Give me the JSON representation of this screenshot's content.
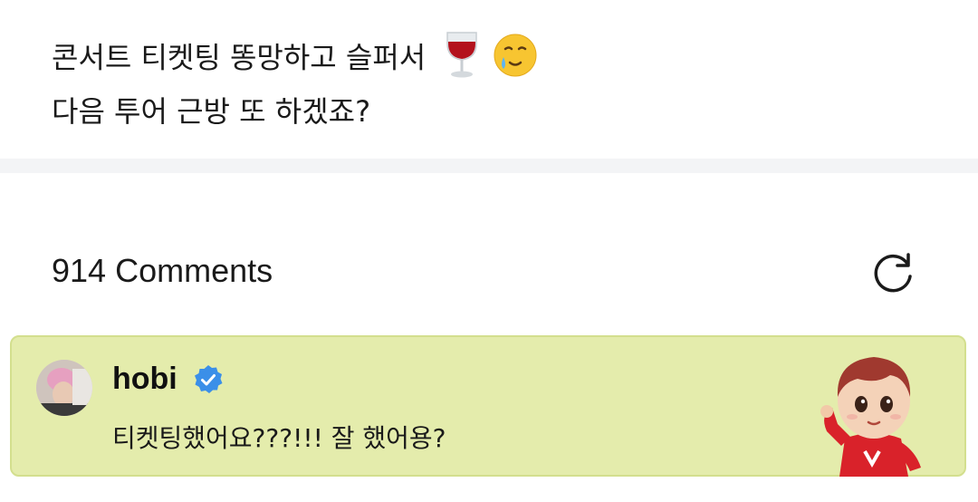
{
  "post": {
    "line1": "콘서트 티켓팅 똥망하고 슬퍼서",
    "line2": "다음 투어 근방 또 하겠죠?",
    "emojis": [
      "wine-glass",
      "face-holding-back-tears"
    ]
  },
  "comments": {
    "count_label": "914 Comments",
    "refresh_icon": "refresh-icon"
  },
  "pinned_comment": {
    "author": "hobi",
    "verified": true,
    "text": "티켓팅했어요???!!! 잘 했어용?",
    "background_color": "#e4ecac",
    "border_color": "#d3df8e",
    "verified_color": "#3b8fe8",
    "sticker": "character-sticker"
  }
}
